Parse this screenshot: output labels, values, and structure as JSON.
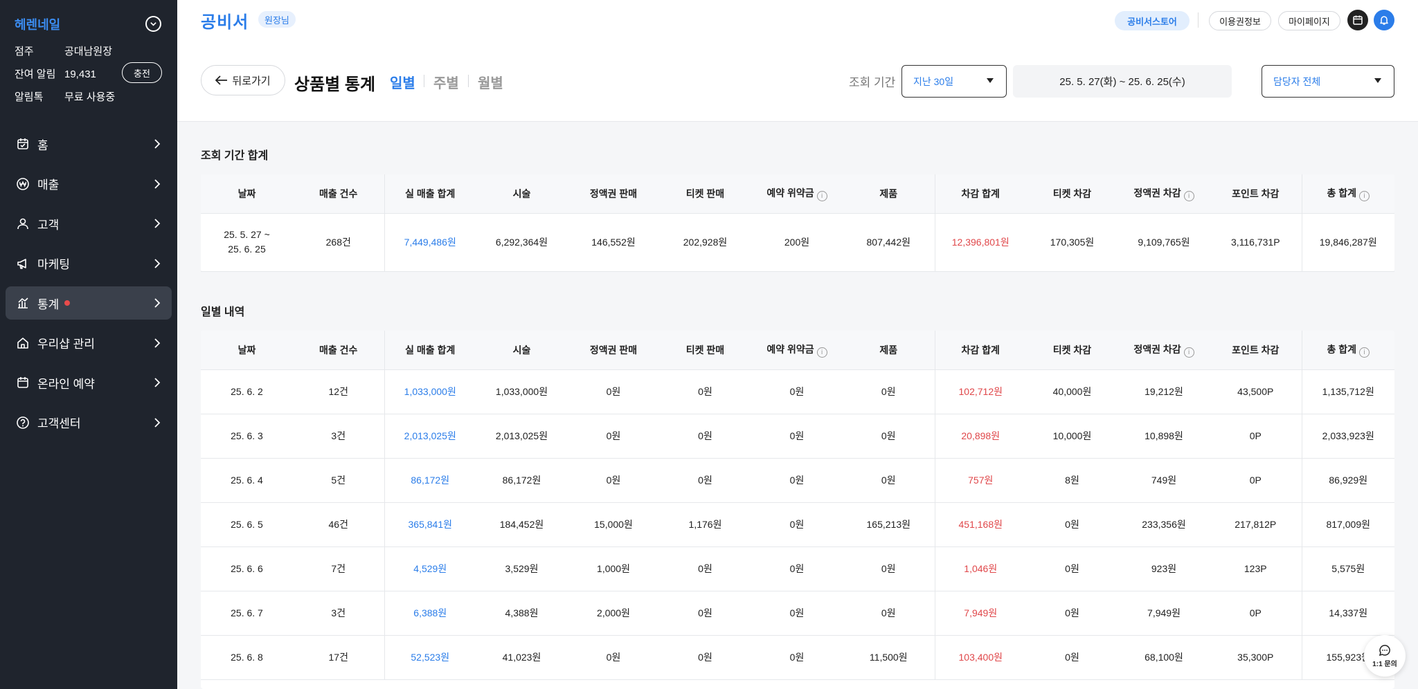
{
  "sidebar": {
    "shop_name": "헤렌네일",
    "info": [
      {
        "key": "점주",
        "value": "공대남원장"
      },
      {
        "key": "잔여 알림",
        "value": "19,431"
      },
      {
        "key": "알림톡",
        "value": "무료 사용중"
      }
    ],
    "charge_label": "충전",
    "nav": [
      {
        "label": "홈",
        "icon": "calendar-check-icon"
      },
      {
        "label": "매출",
        "icon": "won-icon"
      },
      {
        "label": "고객",
        "icon": "person-icon"
      },
      {
        "label": "마케팅",
        "icon": "megaphone-icon"
      },
      {
        "label": "통계",
        "icon": "bar-chart-icon",
        "active": true,
        "dot": true
      },
      {
        "label": "우리샵 관리",
        "icon": "home-icon"
      },
      {
        "label": "온라인 예약",
        "icon": "calendar-icon"
      },
      {
        "label": "고객센터",
        "icon": "help-icon"
      }
    ]
  },
  "topbar": {
    "logo": "공비서",
    "role": "원장님",
    "store": "공비서스토어",
    "pass_info": "이용권정보",
    "mypage": "마이페이지"
  },
  "header": {
    "back": "뒤로가기",
    "title": "상품별 통계",
    "tabs": [
      "일별",
      "주별",
      "월별"
    ],
    "range_label": "조회 기간",
    "range_select": "지난 30일",
    "date_range": "25. 5. 27(화) ~ 25. 6. 25(수)",
    "staff_select": "담당자 전체"
  },
  "columns": [
    "날짜",
    "매출 건수",
    "실 매출 합계",
    "시술",
    "정액권 판매",
    "티켓 판매",
    "예약 위약금",
    "제품",
    "차감 합계",
    "티켓 차감",
    "정액권 차감",
    "포인트 차감",
    "총 합계"
  ],
  "summary": {
    "title": "조회 기간 합계",
    "date_line1": "25. 5. 27 ~",
    "date_line2": "25. 6. 25",
    "count": "268건",
    "net": "7,449,486원",
    "treatment": "6,292,364원",
    "prepaid_sale": "146,552원",
    "ticket_sale": "202,928원",
    "penalty": "200원",
    "product": "807,442원",
    "deduct_total": "12,396,801원",
    "ticket_deduct": "170,305원",
    "prepaid_deduct": "9,109,765원",
    "point_deduct": "3,116,731P",
    "grand_total": "19,846,287원"
  },
  "daily": {
    "title": "일별 내역",
    "rows": [
      [
        "25. 6. 2",
        "12건",
        "1,033,000원",
        "1,033,000원",
        "0원",
        "0원",
        "0원",
        "0원",
        "102,712원",
        "40,000원",
        "19,212원",
        "43,500P",
        "1,135,712원"
      ],
      [
        "25. 6. 3",
        "3건",
        "2,013,025원",
        "2,013,025원",
        "0원",
        "0원",
        "0원",
        "0원",
        "20,898원",
        "10,000원",
        "10,898원",
        "0P",
        "2,033,923원"
      ],
      [
        "25. 6. 4",
        "5건",
        "86,172원",
        "86,172원",
        "0원",
        "0원",
        "0원",
        "0원",
        "757원",
        "8원",
        "749원",
        "0P",
        "86,929원"
      ],
      [
        "25. 6. 5",
        "46건",
        "365,841원",
        "184,452원",
        "15,000원",
        "1,176원",
        "0원",
        "165,213원",
        "451,168원",
        "0원",
        "233,356원",
        "217,812P",
        "817,009원"
      ],
      [
        "25. 6. 6",
        "7건",
        "4,529원",
        "3,529원",
        "1,000원",
        "0원",
        "0원",
        "0원",
        "1,046원",
        "0원",
        "923원",
        "123P",
        "5,575원"
      ],
      [
        "25. 6. 7",
        "3건",
        "6,388원",
        "4,388원",
        "2,000원",
        "0원",
        "0원",
        "0원",
        "7,949원",
        "0원",
        "7,949원",
        "0P",
        "14,337원"
      ],
      [
        "25. 6. 8",
        "17건",
        "52,523원",
        "41,023원",
        "0원",
        "0원",
        "0원",
        "11,500원",
        "103,400원",
        "0원",
        "68,100원",
        "35,300P",
        "155,923원"
      ]
    ]
  },
  "chat": "1:1 문의",
  "colors": {
    "accent": "#2b7de9",
    "negative": "#e0474a",
    "sidebar": "#1f242d"
  }
}
